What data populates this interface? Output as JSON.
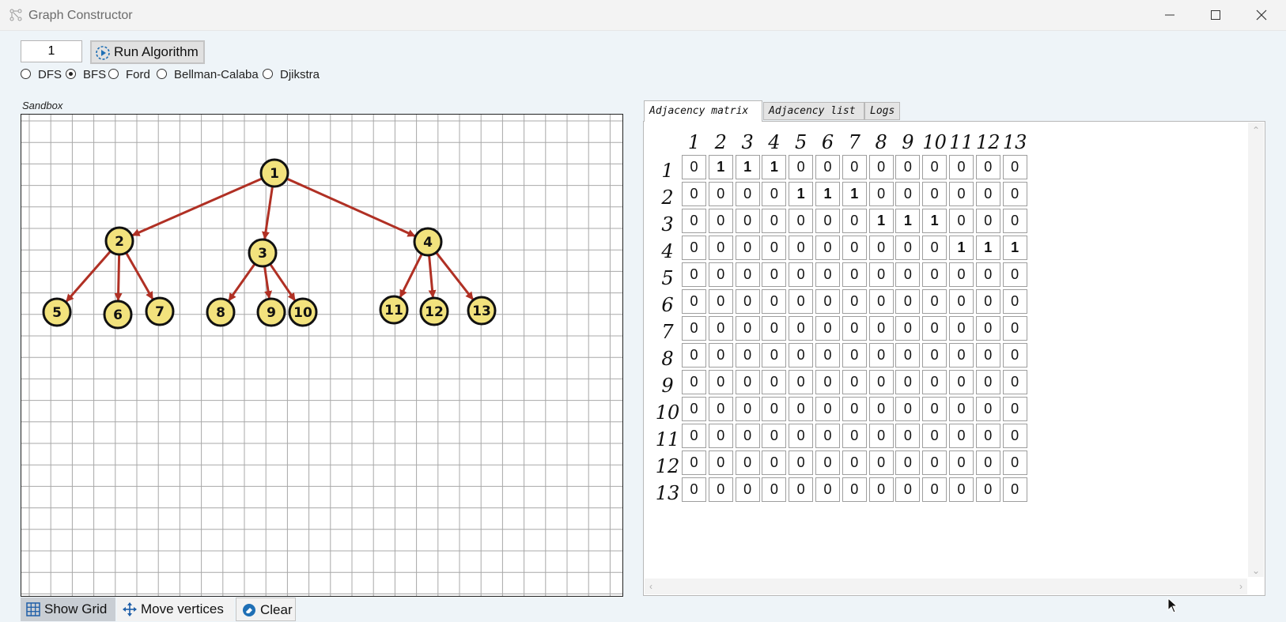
{
  "window": {
    "title": "Graph Constructor"
  },
  "toolbar": {
    "start_vertex_value": "1",
    "run_button_label": "Run Algorithm"
  },
  "algorithms": [
    {
      "label": "DFS",
      "selected": false
    },
    {
      "label": "BFS",
      "selected": true
    },
    {
      "label": "Ford",
      "selected": false
    },
    {
      "label": "Bellman-Calaba",
      "selected": false
    },
    {
      "label": "Djikstra",
      "selected": false
    }
  ],
  "sandbox": {
    "label": "Sandbox",
    "colors": {
      "vertex_fill": "#f2e27d",
      "edge": "#b03024",
      "grid": "#a8a8a8"
    },
    "vertices": [
      "1",
      "2",
      "3",
      "4",
      "5",
      "6",
      "7",
      "8",
      "9",
      "10",
      "11",
      "12",
      "13"
    ],
    "edges": [
      [
        1,
        2
      ],
      [
        1,
        3
      ],
      [
        1,
        4
      ],
      [
        2,
        5
      ],
      [
        2,
        6
      ],
      [
        2,
        7
      ],
      [
        3,
        8
      ],
      [
        3,
        9
      ],
      [
        3,
        10
      ],
      [
        4,
        11
      ],
      [
        4,
        12
      ],
      [
        4,
        13
      ]
    ]
  },
  "bottom_buttons": {
    "show_grid": "Show Grid",
    "move_vertices": "Move vertices",
    "clear": "Clear"
  },
  "tabs": {
    "adjacency_matrix": "Adjacency matrix",
    "adjacency_list": "Adjacency list",
    "logs": "Logs"
  },
  "matrix": {
    "headers": [
      "1",
      "2",
      "3",
      "4",
      "5",
      "6",
      "7",
      "8",
      "9",
      "10",
      "11",
      "12",
      "13"
    ],
    "rows": [
      [
        "0",
        "1",
        "1",
        "1",
        "0",
        "0",
        "0",
        "0",
        "0",
        "0",
        "0",
        "0",
        "0"
      ],
      [
        "0",
        "0",
        "0",
        "0",
        "1",
        "1",
        "1",
        "0",
        "0",
        "0",
        "0",
        "0",
        "0"
      ],
      [
        "0",
        "0",
        "0",
        "0",
        "0",
        "0",
        "0",
        "1",
        "1",
        "1",
        "0",
        "0",
        "0"
      ],
      [
        "0",
        "0",
        "0",
        "0",
        "0",
        "0",
        "0",
        "0",
        "0",
        "0",
        "1",
        "1",
        "1"
      ],
      [
        "0",
        "0",
        "0",
        "0",
        "0",
        "0",
        "0",
        "0",
        "0",
        "0",
        "0",
        "0",
        "0"
      ],
      [
        "0",
        "0",
        "0",
        "0",
        "0",
        "0",
        "0",
        "0",
        "0",
        "0",
        "0",
        "0",
        "0"
      ],
      [
        "0",
        "0",
        "0",
        "0",
        "0",
        "0",
        "0",
        "0",
        "0",
        "0",
        "0",
        "0",
        "0"
      ],
      [
        "0",
        "0",
        "0",
        "0",
        "0",
        "0",
        "0",
        "0",
        "0",
        "0",
        "0",
        "0",
        "0"
      ],
      [
        "0",
        "0",
        "0",
        "0",
        "0",
        "0",
        "0",
        "0",
        "0",
        "0",
        "0",
        "0",
        "0"
      ],
      [
        "0",
        "0",
        "0",
        "0",
        "0",
        "0",
        "0",
        "0",
        "0",
        "0",
        "0",
        "0",
        "0"
      ],
      [
        "0",
        "0",
        "0",
        "0",
        "0",
        "0",
        "0",
        "0",
        "0",
        "0",
        "0",
        "0",
        "0"
      ],
      [
        "0",
        "0",
        "0",
        "0",
        "0",
        "0",
        "0",
        "0",
        "0",
        "0",
        "0",
        "0",
        "0"
      ],
      [
        "0",
        "0",
        "0",
        "0",
        "0",
        "0",
        "0",
        "0",
        "0",
        "0",
        "0",
        "0",
        "0"
      ]
    ]
  }
}
